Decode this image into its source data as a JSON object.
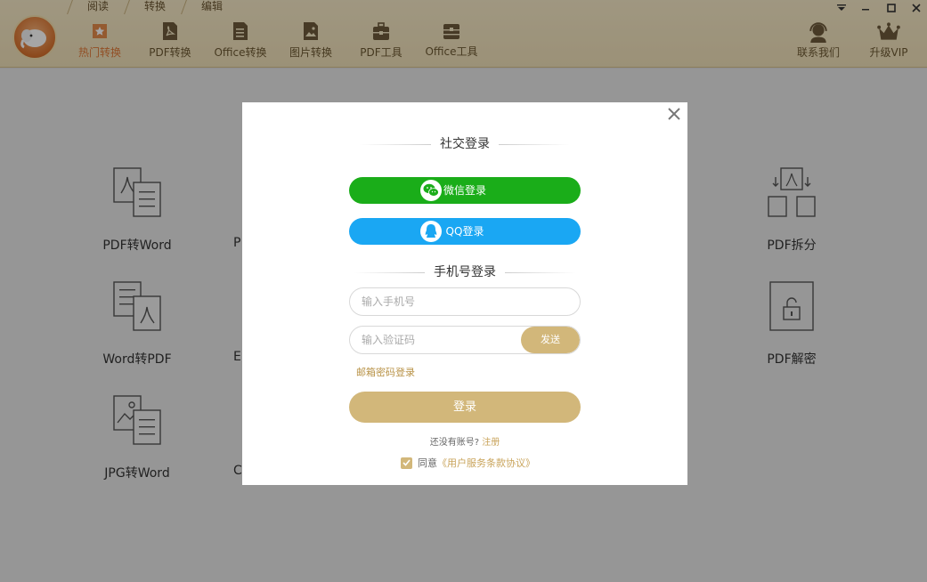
{
  "header": {
    "mode_tabs": [
      "阅读",
      "转换",
      "编辑"
    ],
    "nav_items": [
      {
        "label": "热门转换",
        "icon": "star-icon",
        "active": true
      },
      {
        "label": "PDF转换",
        "icon": "pdf-icon"
      },
      {
        "label": "Office转换",
        "icon": "office-doc-icon"
      },
      {
        "label": "图片转换",
        "icon": "image-icon"
      },
      {
        "label": "PDF工具",
        "icon": "toolbox-icon"
      },
      {
        "label": "Office工具",
        "icon": "office-toolbox-icon"
      }
    ],
    "contact_label": "联系我们",
    "vip_label": "升级VIP",
    "accent_color": "#e07a3a"
  },
  "tools": {
    "pdf_to_word": "PDF转Word",
    "word_to_pdf": "Word转PDF",
    "jpg_to_word": "JPG转Word",
    "pdf_split": "PDF拆分",
    "pdf_decrypt": "PDF解密",
    "partial_col2_row1": "P",
    "partial_col2_row2": "E",
    "partial_col2_row3": "C"
  },
  "modal": {
    "social_title": "社交登录",
    "wechat_label": "微信登录",
    "qq_label": "QQ登录",
    "phone_title": "手机号登录",
    "phone_placeholder": "输入手机号",
    "code_placeholder": "输入验证码",
    "send_label": "发送",
    "email_login": "邮箱密码登录",
    "login_label": "登录",
    "no_account": "还没有账号?",
    "register": "注册",
    "agree_text": "同意",
    "agreement_link": "《用户服务条款协议》",
    "colors": {
      "wechat": "#1aad19",
      "qq": "#1aa7f3",
      "gold": "#d2b77a"
    }
  }
}
